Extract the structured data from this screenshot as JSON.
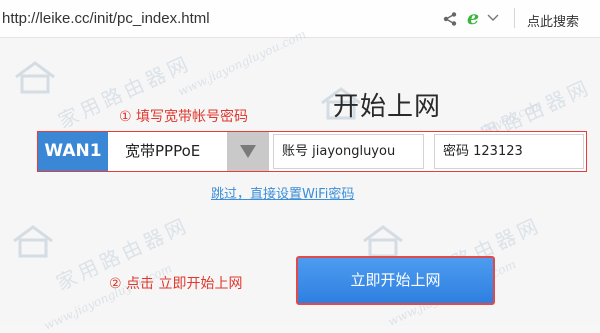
{
  "browser": {
    "url": "http://leike.cc/init/pc_index.html",
    "search_button": "点此搜索",
    "icons": [
      "share-icon",
      "ie-compat-icon",
      "chevron-down-icon"
    ]
  },
  "page": {
    "title": "开始上网",
    "annotation_step1": "① 填写宽带帐号密码",
    "annotation_step2": "② 点击 立即开始上网",
    "wan": {
      "label": "WAN1",
      "connection_type": "宽带PPPoE",
      "account_field": "账号 jiayongluyou",
      "password_field": "密码 123123"
    },
    "skip_link": "跳过，直接设置WiFi密码",
    "start_button": "立即开始上网",
    "watermark_cn": "家用路由器网",
    "watermark_en": "www.jiayongluyou.com"
  },
  "colors": {
    "accent_blue": "#3a87d6",
    "annotation_red": "#e0382f",
    "link_blue": "#3b8ed8",
    "button_blue": "#2f7fe0"
  }
}
